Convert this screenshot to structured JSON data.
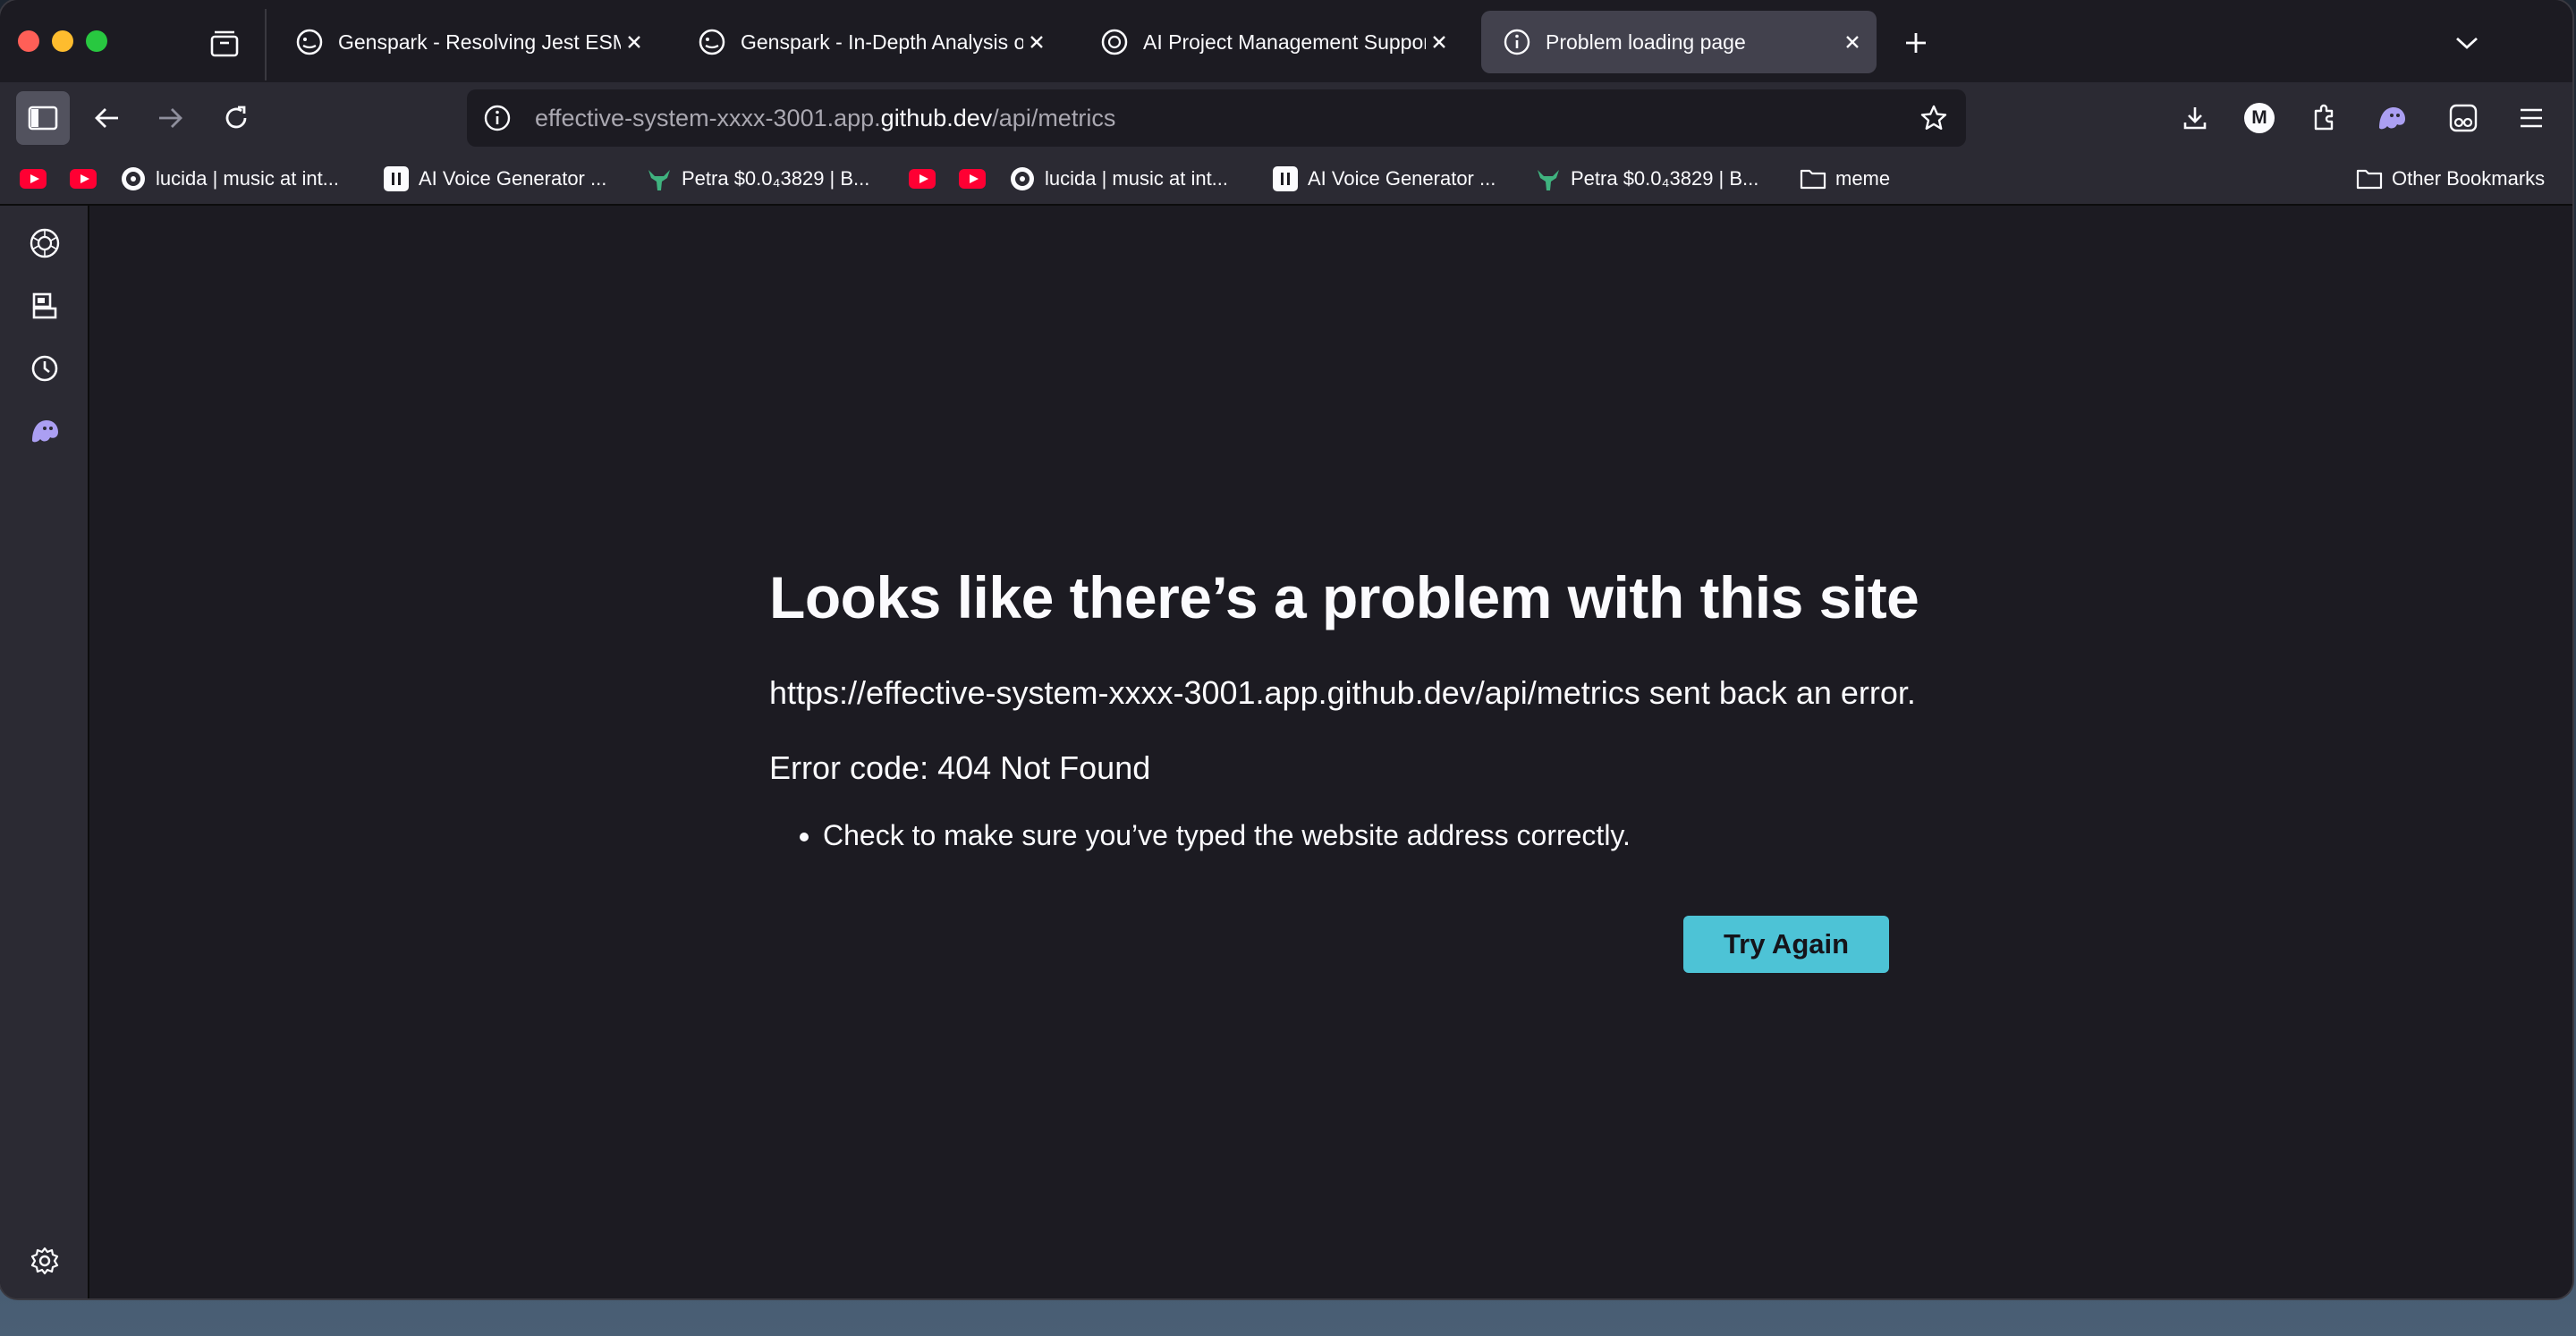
{
  "tabs": [
    {
      "title": "Genspark - Resolving Jest ESM",
      "icon": "genspark-icon",
      "active": false
    },
    {
      "title": "Genspark - In-Depth Analysis of",
      "icon": "genspark-icon",
      "active": false
    },
    {
      "title": "AI Project Management Support",
      "icon": "chatgpt-icon",
      "active": false
    },
    {
      "title": "Problem loading page",
      "icon": "info-icon",
      "active": true
    }
  ],
  "urlbar": {
    "prefix": "effective-system-xxxx-3001.app.",
    "host": "github.dev",
    "path": "/api/metrics"
  },
  "toolbar": {
    "account_initial": "M"
  },
  "bookmarks": [
    {
      "label": "",
      "icon": "youtube-icon"
    },
    {
      "label": "",
      "icon": "youtube-icon"
    },
    {
      "label": "lucida | music at int...",
      "icon": "lucida-icon"
    },
    {
      "label": "AI Voice Generator ...",
      "icon": "pause-icon"
    },
    {
      "label": "Petra $0.0₄3829 | B...",
      "icon": "bull-icon"
    },
    {
      "label": "",
      "icon": "youtube-icon"
    },
    {
      "label": "",
      "icon": "youtube-icon"
    },
    {
      "label": "lucida | music at int...",
      "icon": "lucida-icon"
    },
    {
      "label": "AI Voice Generator ...",
      "icon": "pause-icon"
    },
    {
      "label": "Petra $0.0₄3829 | B...",
      "icon": "bull-icon"
    },
    {
      "label": "meme",
      "icon": "folder-icon"
    }
  ],
  "other_bookmarks": "Other Bookmarks",
  "error": {
    "title": "Looks like there’s a problem with this site",
    "description": "https://effective-system-xxxx-3001.app.github.dev/api/metrics sent back an error.",
    "code": "Error code: 404 Not Found",
    "tips": [
      "Check to make sure you’ve typed the website address correctly."
    ],
    "button": "Try Again"
  },
  "colors": {
    "accent": "#4dc3d6",
    "background": "#1c1b22",
    "toolbar": "#2b2a33"
  }
}
